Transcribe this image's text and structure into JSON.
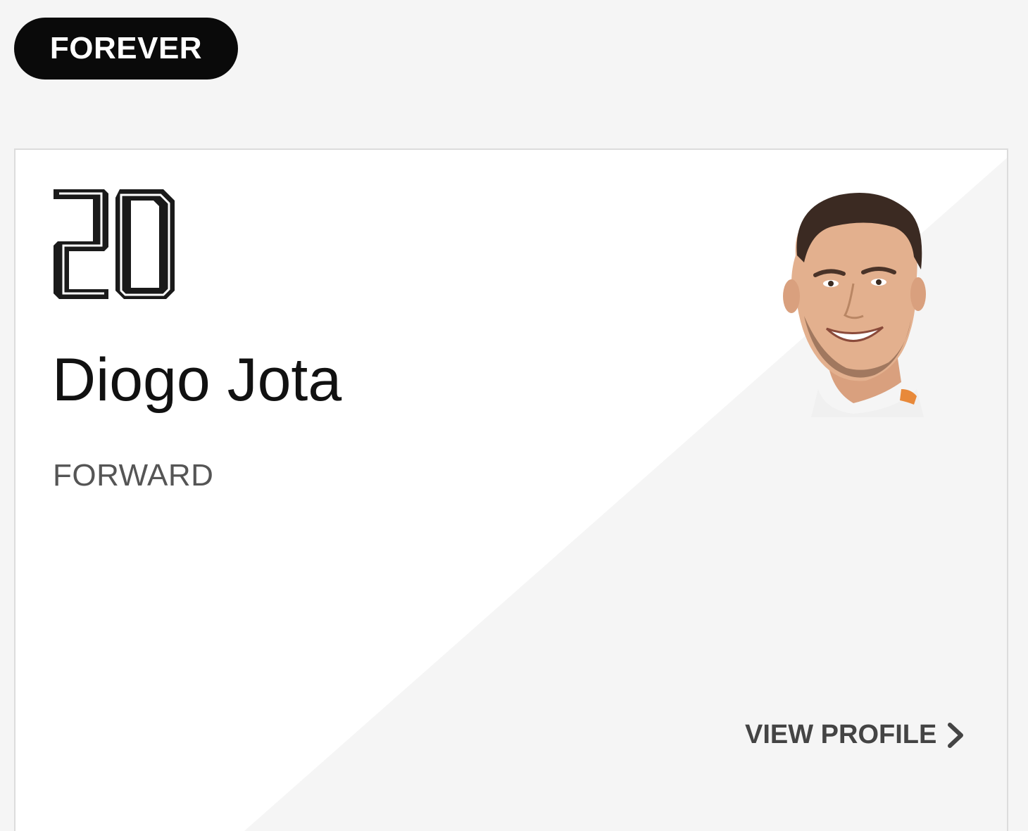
{
  "badge": {
    "label": "FOREVER"
  },
  "player": {
    "number": "20",
    "name": "Diogo Jota",
    "position": "FORWARD",
    "photo_icon": "player-headshot"
  },
  "actions": {
    "view_profile_label": "VIEW PROFILE",
    "chevron_icon": "chevron-right-icon"
  },
  "colors": {
    "page_background": "#f5f5f5",
    "card_white": "#ffffff",
    "badge_background": "#0a0a0a",
    "badge_text": "#ffffff",
    "name_text": "#111111",
    "position_text": "#555555",
    "link_text": "#444444"
  }
}
